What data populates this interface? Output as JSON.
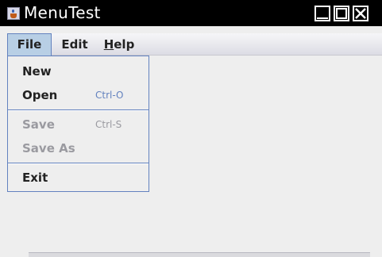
{
  "window": {
    "title": "MenuTest",
    "icon": "java-cup-icon",
    "controls": [
      "minimize-icon",
      "maximize-icon",
      "close-icon"
    ]
  },
  "menubar": {
    "menus": [
      {
        "label": "File",
        "open": true
      },
      {
        "label": "Edit"
      },
      {
        "label": "Help",
        "mnemonic": "H"
      }
    ]
  },
  "file_menu": {
    "items": [
      {
        "label": "New",
        "accelerator": "",
        "enabled": true
      },
      {
        "label": "Open",
        "accelerator": "Ctrl-O",
        "enabled": true
      },
      {
        "label": "Save",
        "accelerator": "Ctrl-S",
        "enabled": false
      },
      {
        "label": "Save As",
        "accelerator": "",
        "enabled": false
      },
      {
        "label": "Exit",
        "accelerator": "",
        "enabled": true
      }
    ]
  },
  "colors": {
    "menu_highlight": "#b8cfe5",
    "menu_border": "#6382bf",
    "accelerator": "#6382bf",
    "disabled_text": "#9a9aa0",
    "background": "#eeeeee"
  }
}
